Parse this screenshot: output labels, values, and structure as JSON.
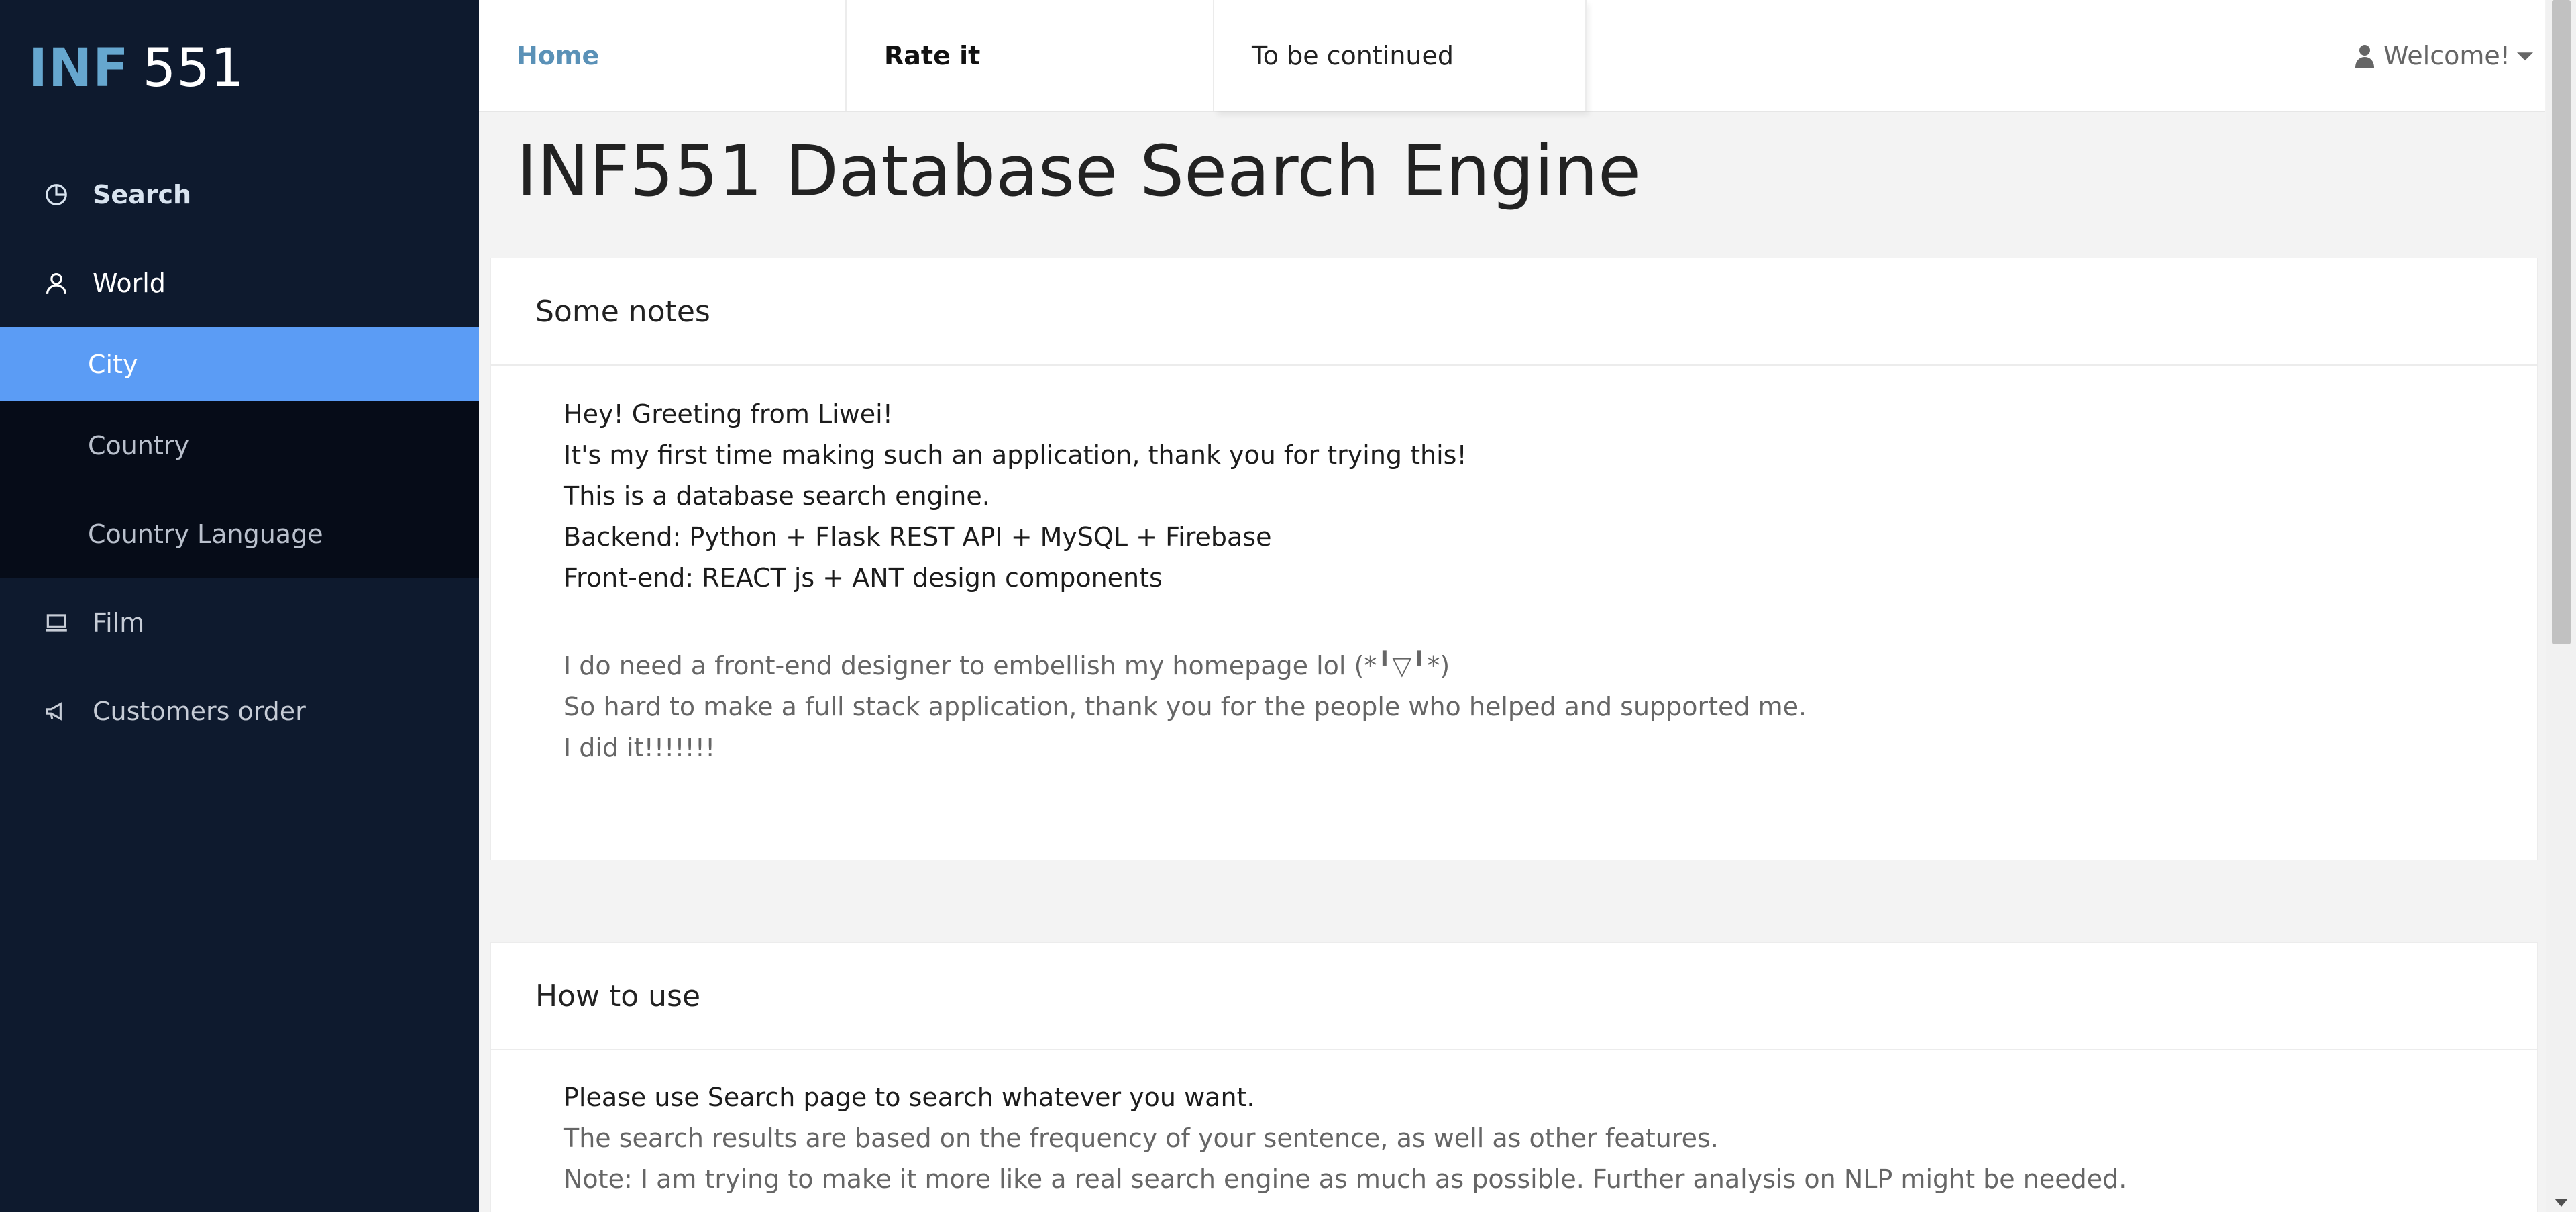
{
  "sidebar": {
    "logo": {
      "left": "INF",
      "right": "551"
    },
    "items": [
      {
        "label": "Search",
        "icon": "pie-chart-icon"
      },
      {
        "label": "World",
        "icon": "user-icon"
      },
      {
        "label": "City"
      },
      {
        "label": "Country"
      },
      {
        "label": "Country Language"
      },
      {
        "label": "Film",
        "icon": "laptop-icon"
      },
      {
        "label": "Customers order",
        "icon": "megaphone-icon"
      }
    ],
    "active_item": "City"
  },
  "topbar": {
    "tabs": [
      {
        "label": "Home"
      },
      {
        "label": "Rate it"
      },
      {
        "label": "To be continued"
      }
    ],
    "welcome": "Welcome!"
  },
  "page": {
    "title": "INF551 Database Search Engine"
  },
  "notes_card": {
    "title": "Some notes",
    "strong_lines": [
      "Hey! Greeting from Liwei!",
      "It's my first time making such an application, thank you for trying this!",
      "This is a database search engine.",
      "Backend: Python + Flask REST API + MySQL + Firebase",
      "Front-end: REACT js + ANT design components"
    ],
    "muted_lines": [
      "I do need a front-end designer to embellish my homepage lol (*╹▽╹*)",
      "So hard to make a full stack application, thank you for the people who helped and supported me.",
      "I did it!!!!!!!"
    ]
  },
  "howto_card": {
    "title": "How to use",
    "strong_line": "Please use Search page to search whatever you want.",
    "muted_lines": [
      "The search results are based on the frequency of your sentence, as well as other features.",
      "Note: I am trying to make it more like a real search engine as much as possible. Further analysis on NLP might be needed."
    ]
  },
  "colors": {
    "sidebar_bg": "#0e1a2e",
    "submenu_bg": "#060c18",
    "active_item": "#5b9cf5",
    "logo_accent": "#66a7cf",
    "home_tab": "#5a91b7"
  }
}
